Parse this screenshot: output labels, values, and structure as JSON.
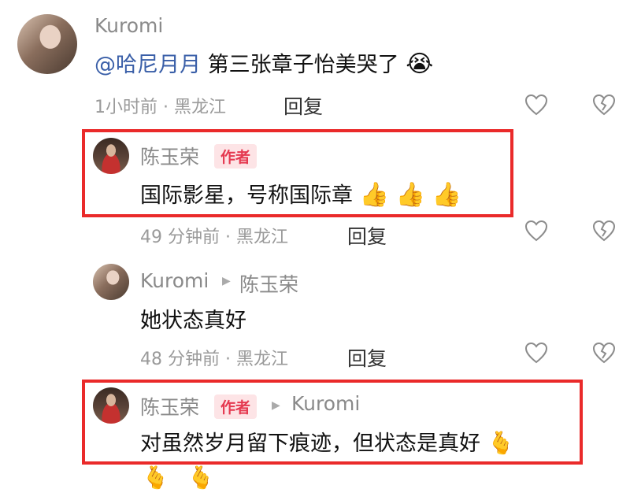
{
  "comments": [
    {
      "author": "Kuromi",
      "mention": "@哈尼月月",
      "text": "第三张章子怡美哭了",
      "emoji": "😭",
      "time": "1小时前",
      "location": "黑龙江",
      "reply_label": "回复"
    },
    {
      "author": "陈玉荣",
      "badge": "作者",
      "text": "国际影星，号称国际章",
      "emojis": [
        "👍",
        "👍",
        "👍"
      ],
      "time": "49 分钟前",
      "location": "黑龙江",
      "reply_label": "回复"
    },
    {
      "author": "Kuromi",
      "reply_to": "陈玉荣",
      "text": "她状态真好",
      "time": "48 分钟前",
      "location": "黑龙江",
      "reply_label": "回复"
    },
    {
      "author": "陈玉荣",
      "badge": "作者",
      "reply_to": "Kuromi",
      "text": "对虽然岁月留下痕迹，但状态是真好",
      "emojis": [
        "🫰",
        "🫰",
        "🫰"
      ]
    }
  ],
  "separator": "·",
  "colors": {
    "highlight_border": "#ea2a2a",
    "badge_bg": "#fde4e6",
    "badge_text": "#e53950",
    "mention": "#3a5fa8"
  },
  "icons": [
    "heart-outline-icon",
    "broken-heart-icon",
    "play-arrow-icon"
  ]
}
